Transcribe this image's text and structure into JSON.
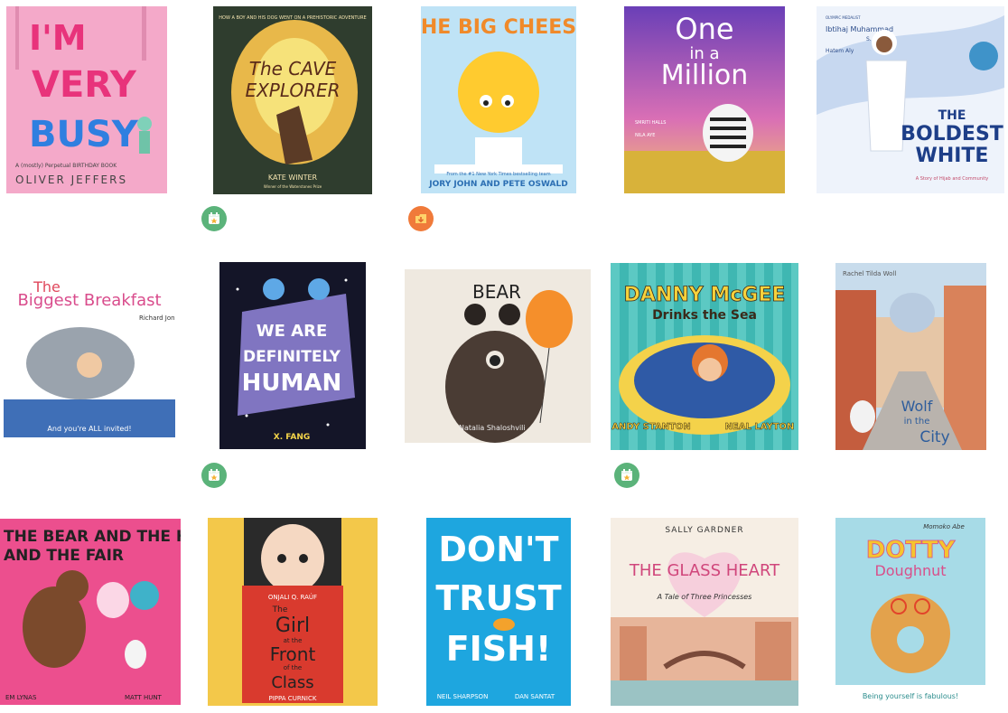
{
  "books": [
    {
      "title_lines": [
        "I'M",
        "VERY",
        "BUSY"
      ],
      "author": "OLIVER JEFFERS",
      "subtitle": "A (mostly) Perpetual BIRTHDAY BOOK"
    },
    {
      "title_lines": [
        "The CAVE",
        "EXPLORER"
      ],
      "author": "KATE WINTER",
      "tagline": "HOW A BOY AND HIS DOG WENT ON A PREHISTORIC ADVENTURE",
      "author_note": "Winner of the Waterstones Prize"
    },
    {
      "title_lines": [
        "THE BIG CHEESE"
      ],
      "author": "JORY JOHN AND PETE OSWALD",
      "tagline": "From the #1 New York Times bestselling team"
    },
    {
      "title_lines": [
        "One",
        "in a",
        "Million"
      ],
      "author": "SMRITI HALLS",
      "illustrator": "NILA AYE"
    },
    {
      "title_lines": [
        "THE",
        "BOLDEST",
        "WHITE"
      ],
      "author": "Ibtihaj Muhammad",
      "coauthor": "S. K. Ali",
      "illustrator": "Hatem Aly",
      "subtitle": "A Story of Hijab and Community",
      "tagline": "OLYMPIC MEDALIST"
    },
    {
      "title_lines": [
        "The",
        "Biggest Breakfast"
      ],
      "author": "Richard Jones",
      "tagline": "And you're ALL invited!"
    },
    {
      "title_lines": [
        "WE ARE",
        "DEFINITELY",
        "HUMAN"
      ],
      "author": "X. FANG"
    },
    {
      "title_lines": [
        "BEAR"
      ],
      "author": "Natalia Shaloshvili"
    },
    {
      "title_lines": [
        "DANNY McGEE",
        "Drinks the Sea"
      ],
      "author": "ANDY STANTON",
      "illustrator": "NEAL LAYTON"
    },
    {
      "title_lines": [
        "Wolf",
        "in the",
        "City"
      ],
      "author": "Rachel Tilda Woll"
    },
    {
      "title_lines": [
        "THE BEAR AND THE HARE",
        "AND THE FAIR"
      ],
      "author": "EM LYNAS",
      "illustrator": "MATT HUNT"
    },
    {
      "title_lines": [
        "The",
        "Girl",
        "at the",
        "Front",
        "of the",
        "Class"
      ],
      "author": "ONJALI Q. RAÚF",
      "illustrator": "PIPPA CURNICK"
    },
    {
      "title_lines": [
        "DON'T",
        "TRUST",
        "FISH!"
      ],
      "author": "NEIL SHARPSON",
      "illustrator": "DAN SANTAT"
    },
    {
      "title_lines": [
        "THE GLASS HEART"
      ],
      "author": "SALLY GARDNER",
      "subtitle": "A Tale of Three Princesses"
    },
    {
      "title_lines": [
        "DOTTY",
        "Doughnut"
      ],
      "author": "Momoko Abe",
      "tagline": "Being yourself is fabulous!"
    }
  ],
  "badges": [
    {
      "type": "calendar-star-icon",
      "color": "#5bb37a"
    },
    {
      "type": "download-icon",
      "color": "#f07a3a"
    },
    {
      "type": "calendar-star-icon",
      "color": "#5bb37a"
    },
    {
      "type": "calendar-star-icon",
      "color": "#5bb37a"
    }
  ]
}
